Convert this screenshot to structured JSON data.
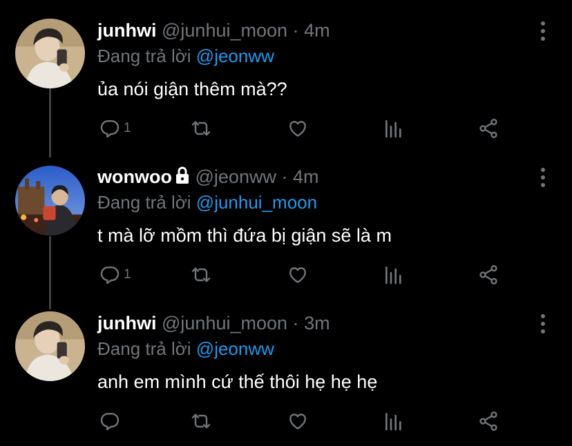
{
  "tweets": [
    {
      "name": "junhwi",
      "handle": "@junhui_moon",
      "time": "4m",
      "reply_prefix": "Đang trả lời",
      "reply_to": "@jeonww",
      "text": "ủa nói giận thêm mà??",
      "reply_count": "1",
      "locked": false
    },
    {
      "name": "wonwoo",
      "handle": "@jeonww",
      "time": "4m",
      "reply_prefix": "Đang trả lời",
      "reply_to": "@junhui_moon",
      "text": "t mà lỡ mồm thì đứa bị giận sẽ là m",
      "reply_count": "1",
      "locked": true
    },
    {
      "name": "junhwi",
      "handle": "@junhui_moon",
      "time": "3m",
      "reply_prefix": "Đang trả lời",
      "reply_to": "@jeonww",
      "text": "anh em mình cứ thế thôi hẹ hẹ hẹ",
      "reply_count": "",
      "locked": false
    }
  ],
  "separator": "·",
  "colors": {
    "background": "#000000",
    "text": "#ffffff",
    "muted": "#71767b",
    "accent": "#1d9bf0",
    "thread_line": "#3d4145"
  },
  "icons": [
    "reply-icon",
    "retweet-icon",
    "like-icon",
    "views-icon",
    "share-icon",
    "more-icon",
    "lock-icon"
  ]
}
